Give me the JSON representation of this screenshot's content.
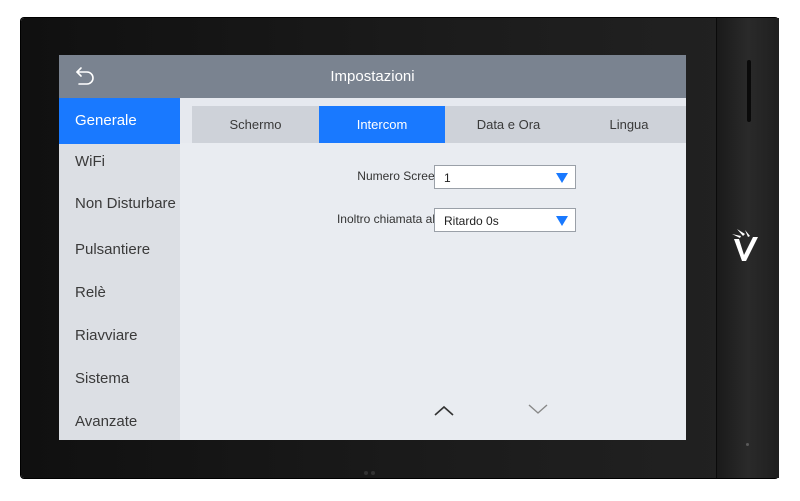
{
  "header": {
    "title": "Impostazioni",
    "back_icon": "back-arrow-icon"
  },
  "sidebar": {
    "items": [
      {
        "label": "Generale",
        "active": true
      },
      {
        "label": "WiFi",
        "active": false
      },
      {
        "label": "Non Disturbare",
        "active": false
      },
      {
        "label": "Pulsantiere",
        "active": false
      },
      {
        "label": "Relè",
        "active": false
      },
      {
        "label": "Riavviare",
        "active": false
      },
      {
        "label": "Sistema",
        "active": false
      },
      {
        "label": "Avanzate",
        "active": false
      }
    ]
  },
  "tabs": [
    {
      "label": "Schermo",
      "active": false
    },
    {
      "label": "Intercom",
      "active": true
    },
    {
      "label": "Data e Ora",
      "active": false
    },
    {
      "label": "Lingua",
      "active": false
    }
  ],
  "settings": {
    "screenshot_count": {
      "label": "Numero Screenshot",
      "value": "1"
    },
    "call_forward": {
      "label": "Inoltro chiamata all'APP",
      "value": "Ritardo 0s"
    }
  },
  "pager": {
    "up_icon": "chevron-up-icon",
    "down_icon": "chevron-down-icon"
  },
  "colors": {
    "accent": "#1979ff",
    "titlebar": "#7a8390",
    "sidebar_bg": "#dcdfe4",
    "content_bg": "#e9ecf1"
  }
}
